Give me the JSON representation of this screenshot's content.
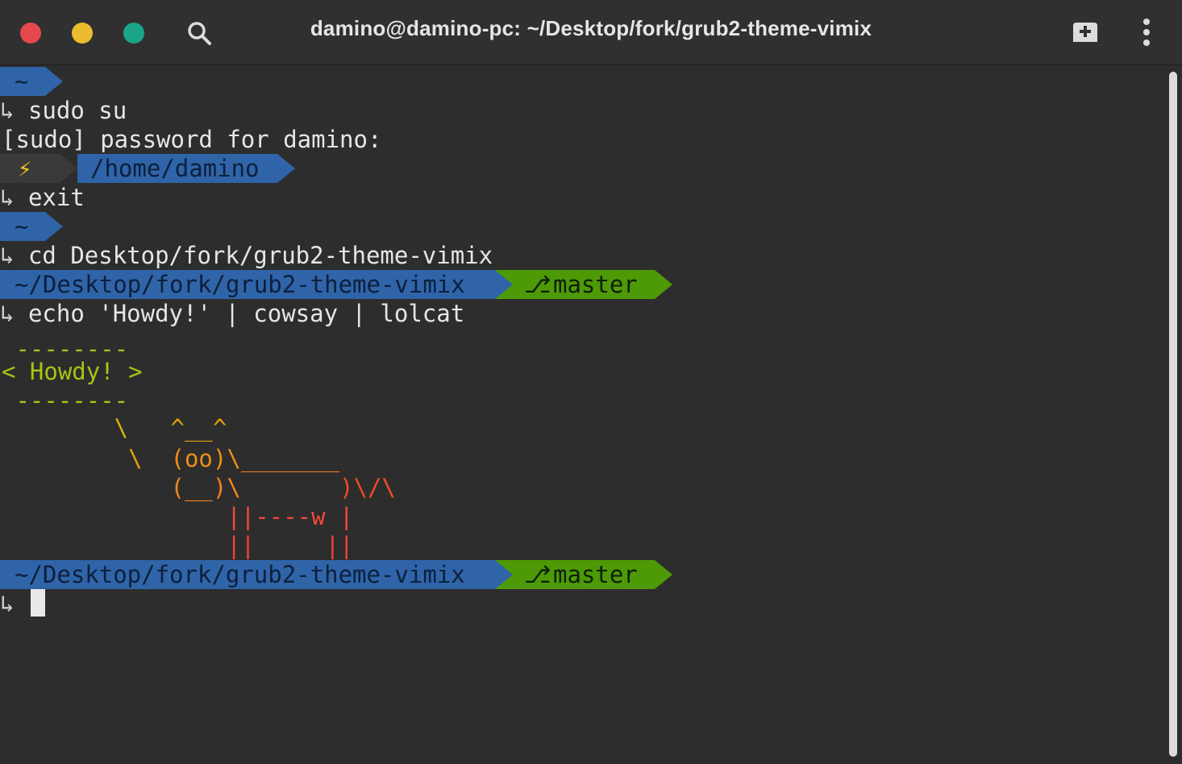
{
  "window": {
    "title": "damino@damino-pc: ~/Desktop/fork/grub2-theme-vimix",
    "colors": {
      "close": "#e5484d",
      "minimize": "#ebbd2e",
      "maximize": "#1aa58a",
      "prompt_blue": "#2f64a8",
      "prompt_green": "#4e9a06"
    },
    "icons": {
      "search": "search-icon",
      "new_tab": "new-tab-icon",
      "menu": "kebab-menu-icon"
    }
  },
  "terminal": {
    "prompt_arrow": "↳",
    "prompts": {
      "home_1": "~",
      "root_icon": "⚡",
      "root_path": "/home/damino",
      "home_2": "~",
      "repo_path_1": "~/Desktop/fork/grub2-theme-vimix",
      "branch_icon": "⎇",
      "branch_1": "master",
      "repo_path_2": "~/Desktop/fork/grub2-theme-vimix",
      "branch_2": "master"
    },
    "commands": {
      "cmd1": "sudo su",
      "sudo_prompt": "[sudo] password for damino:",
      "cmd2": "exit",
      "cmd3": "cd Desktop/fork/grub2-theme-vimix",
      "cmd4": "echo 'Howdy!' | cowsay | lolcat"
    },
    "cowsay": {
      "top": " --------",
      "speech": "< Howdy! >",
      "bottom": " --------",
      "l1_a": "        \\   ",
      "l1_b": "^__^",
      "l2_a": "         \\  ",
      "l2_b": "(oo)\\",
      "l2_c": "_______",
      "l3_a": "            ",
      "l3_b": "(__)\\",
      "l3_c": "       ",
      "l3_d": ")\\/\\",
      "l4": "                ||----w |",
      "l5": "                ||     ||"
    }
  }
}
